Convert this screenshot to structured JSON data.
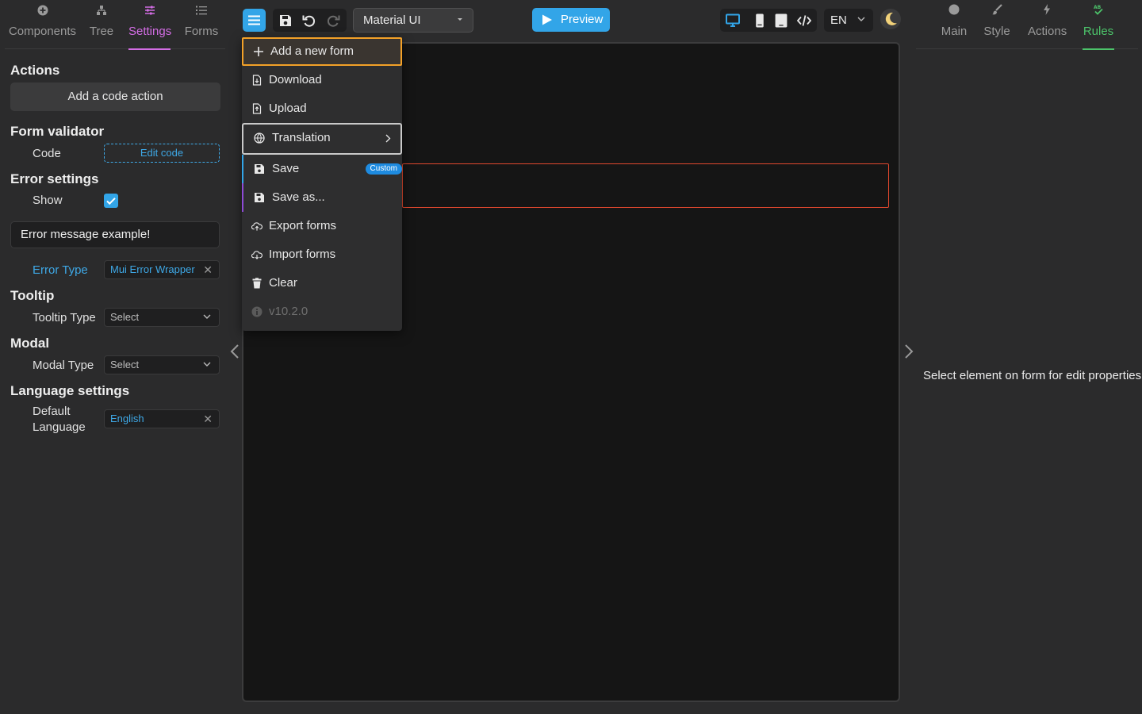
{
  "left_tabs": [
    {
      "label": "Components",
      "icon": "plus-circle-icon"
    },
    {
      "label": "Tree",
      "icon": "tree-icon"
    },
    {
      "label": "Settings",
      "icon": "sliders-icon"
    },
    {
      "label": "Forms",
      "icon": "list-icon"
    }
  ],
  "settings": {
    "actions_title": "Actions",
    "add_code_action": "Add a code action",
    "form_validator_title": "Form validator",
    "code_label": "Code",
    "edit_code": "Edit code",
    "error_settings_title": "Error settings",
    "show_label": "Show",
    "show_checked": true,
    "error_message_example": "Error message example!",
    "error_type_label": "Error Type",
    "error_type_value": "Mui Error Wrapper",
    "tooltip_title": "Tooltip",
    "tooltip_type_label": "Tooltip Type",
    "tooltip_type_value": "Select",
    "modal_title": "Modal",
    "modal_type_label": "Modal Type",
    "modal_type_value": "Select",
    "language_title": "Language settings",
    "default_language_label_1": "Default",
    "default_language_label_2": "Language",
    "default_language_value": "English"
  },
  "toolbar": {
    "theme": "Material UI",
    "preview": "Preview",
    "lang": "EN"
  },
  "menu": {
    "items": [
      {
        "label": "Add a new form",
        "icon": "plus-icon"
      },
      {
        "label": "Download",
        "icon": "download-file-icon"
      },
      {
        "label": "Upload",
        "icon": "upload-file-icon"
      },
      {
        "label": "Translation",
        "icon": "globe-icon"
      },
      {
        "label": "Save",
        "icon": "floppy-disk-icon",
        "badge": "Custom"
      },
      {
        "label": "Save as...",
        "icon": "floppy-disk-icon"
      },
      {
        "label": "Export forms",
        "icon": "cloud-upload-icon"
      },
      {
        "label": "Import forms",
        "icon": "cloud-download-icon"
      },
      {
        "label": "Clear",
        "icon": "trash-icon"
      },
      {
        "label": "v10.2.0",
        "icon": "info-icon"
      }
    ]
  },
  "right_tabs": [
    {
      "label": "Main",
      "icon": "circle-icon"
    },
    {
      "label": "Style",
      "icon": "brush-icon"
    },
    {
      "label": "Actions",
      "icon": "lightning-icon"
    },
    {
      "label": "Rules",
      "icon": "spellcheck-icon"
    }
  ],
  "right_hint": "Select element on form for edit properties",
  "colors": {
    "accent_blue": "#32a5e8",
    "settings_pink": "#d36de4",
    "rules_green": "#4cc36a",
    "highlight_orange": "#f3a128",
    "error_red": "#e0482e"
  }
}
